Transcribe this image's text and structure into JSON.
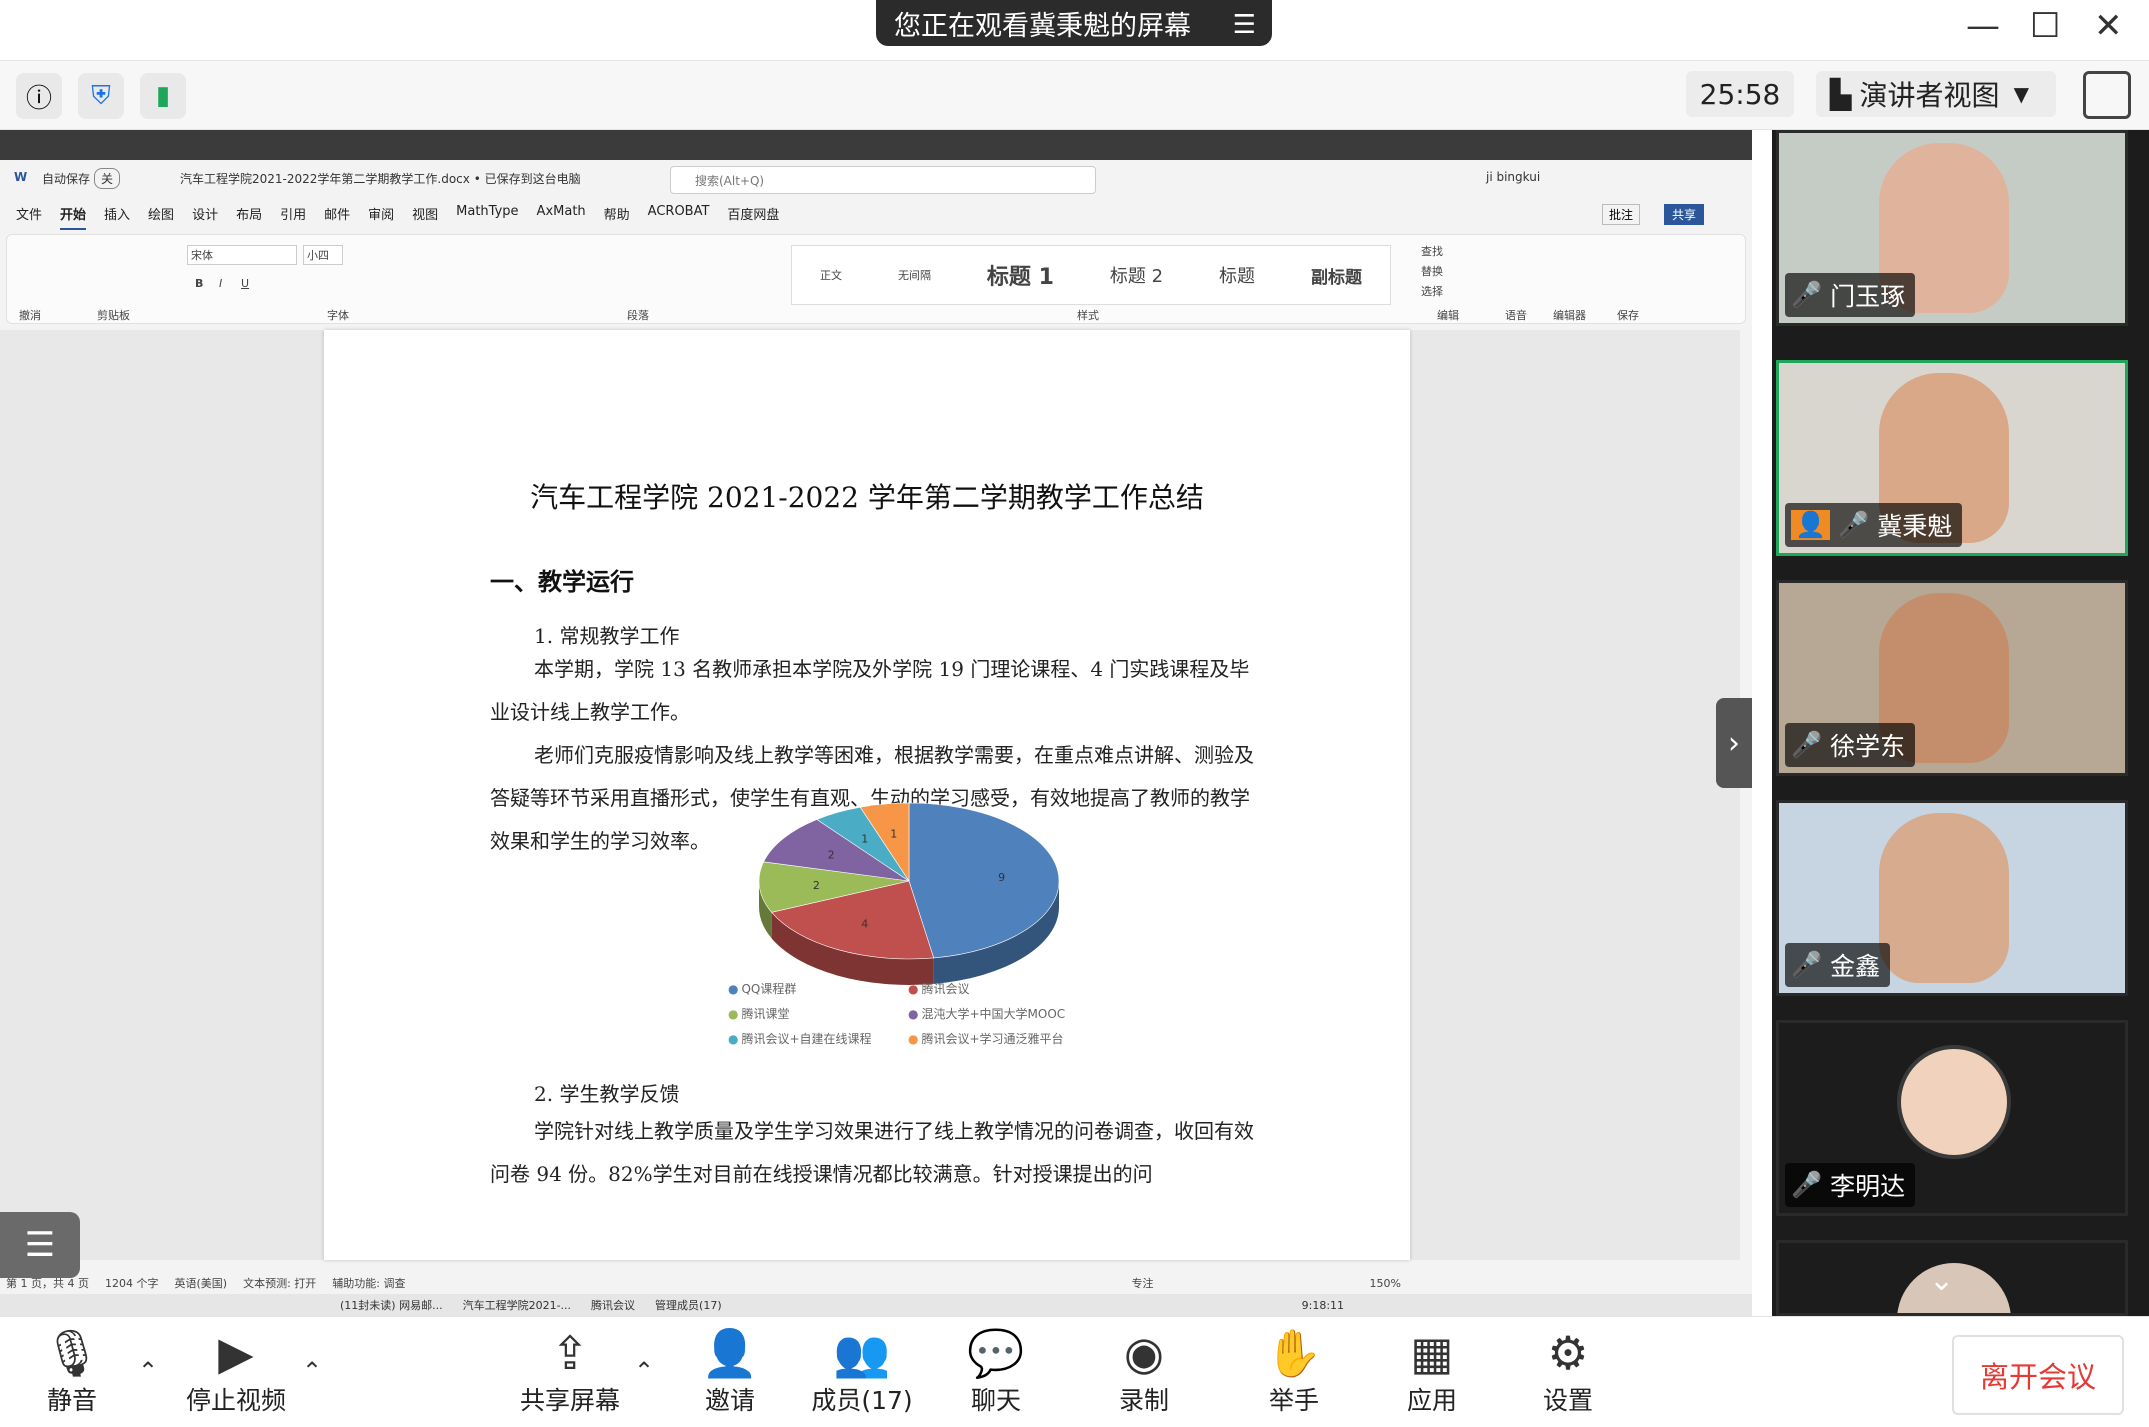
{
  "sharing_banner": "您正在观看冀秉魁的屏幕",
  "timer": "25:58",
  "view_mode": "演讲者视图",
  "word": {
    "autosave_label": "自动保存",
    "autosave_state": "关",
    "filename": "汽车工程学院2021-2022学年第二学期教学工作.docx • 已保存到这台电脑",
    "search_placeholder": "搜索(Alt+Q)",
    "user": "ji bingkui",
    "tabs": [
      "文件",
      "开始",
      "插入",
      "绘图",
      "设计",
      "布局",
      "引用",
      "邮件",
      "审阅",
      "视图",
      "MathType",
      "AxMath",
      "帮助",
      "ACROBAT",
      "百度网盘"
    ],
    "comment_btn": "批注",
    "share_btn": "共享",
    "font_name": "宋体",
    "font_size": "小四",
    "styles": [
      "正文",
      "无间隔",
      "标题 1",
      "标题 2",
      "标题",
      "副标题"
    ],
    "groups": [
      "撤消",
      "剪贴板",
      "字体",
      "段落",
      "样式",
      "编辑",
      "语音",
      "编辑器",
      "保存"
    ],
    "edit_items": [
      "查找",
      "替换",
      "选择"
    ],
    "status": [
      "第 1 页，共 4 页",
      "1204 个字",
      "英语(美国)",
      "文本预测: 打开",
      "辅助功能: 调查"
    ],
    "zoom": "150%",
    "focus_label": "专注"
  },
  "document": {
    "title": "汽车工程学院 2021-2022 学年第二学期教学工作总结",
    "heading1": "一、教学运行",
    "sub1": "1. 常规教学工作",
    "para1": "本学期，学院 13 名教师承担本学院及外学院 19 门理论课程、4 门实践课程及毕业设计线上教学工作。",
    "para2": "老师们克服疫情影响及线上教学等困难，根据教学需要，在重点难点讲解、测验及答疑等环节采用直播形式，使学生有直观、生动的学习感受，有效地提高了教师的教学效果和学生的学习效率。",
    "sub2": "2. 学生教学反馈",
    "para3": "学院针对线上教学质量及学生学习效果进行了线上教学情况的问卷调查，收回有效问卷 94 份。82%学生对目前在线授课情况都比较满意。针对授课提出的问"
  },
  "chart_data": {
    "type": "pie",
    "categories": [
      "QQ课程群",
      "腾讯会议",
      "腾讯课堂",
      "混沌大学+中国大学MOOC",
      "腾讯会议+自建在线课程",
      "腾讯会议+学习通泛雅平台"
    ],
    "values": [
      9,
      4,
      2,
      2,
      1,
      1
    ],
    "value_labels": [
      "9",
      "4",
      "2",
      "2",
      "1",
      "1"
    ],
    "colors": [
      "#4f81bd",
      "#c0504d",
      "#9bbb59",
      "#8064a2",
      "#4bacc6",
      "#f79646"
    ]
  },
  "taskbar": [
    "(11封未读) 网易邮...",
    "汽车工程学院2021-...",
    "腾讯会议",
    "管理成员(17)"
  ],
  "taskbar_clock": "9:18:11",
  "participants": [
    {
      "name": "门玉琢",
      "mic": "on",
      "active": false
    },
    {
      "name": "冀秉魁",
      "mic": "on",
      "active": true
    },
    {
      "name": "徐学东",
      "mic": "off",
      "active": false
    },
    {
      "name": "金鑫",
      "mic": "off",
      "active": false
    },
    {
      "name": "李明达",
      "mic": "off",
      "active": false
    }
  ],
  "controls": {
    "mute": "静音",
    "stop_video": "停止视频",
    "share_screen": "共享屏幕",
    "invite": "邀请",
    "members": "成员(17)",
    "chat": "聊天",
    "record": "录制",
    "raise_hand": "举手",
    "apps": "应用",
    "settings": "设置",
    "leave": "离开会议"
  }
}
